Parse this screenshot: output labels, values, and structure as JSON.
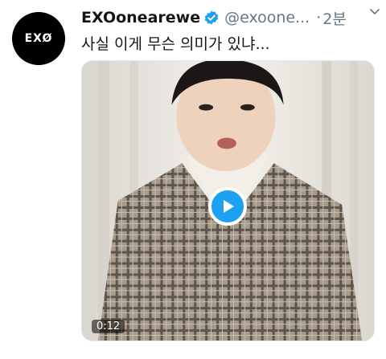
{
  "tweet": {
    "avatar_logo": "EXØ",
    "display_name": "EXOonearewe",
    "handle": "@exoone...",
    "separator": "·",
    "time": "2분",
    "text": "사실 이게 무슨 의미가 있냐...",
    "icons": {
      "verified": "verified-badge-icon",
      "caret": "chevron-down-icon",
      "play": "play-icon"
    },
    "colors": {
      "accent": "#1da1f2",
      "muted": "#657786",
      "text": "#14171a"
    }
  },
  "media": {
    "type": "video",
    "duration": "0:12"
  }
}
